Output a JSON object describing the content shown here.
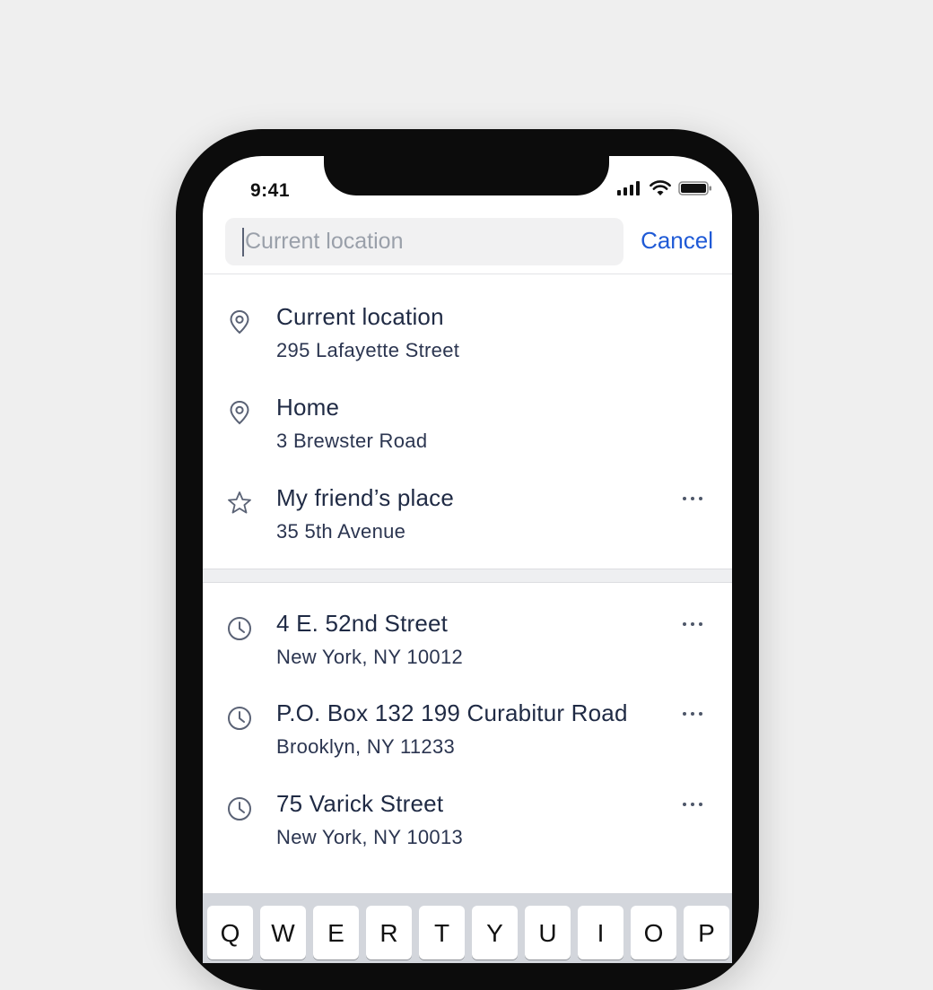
{
  "status_bar": {
    "time": "9:41"
  },
  "search": {
    "placeholder": "Current location",
    "value": "",
    "cancel_label": "Cancel"
  },
  "saved_places": [
    {
      "icon": "location-pin-icon",
      "title": "Current location",
      "subtitle": "295 Lafayette Street",
      "has_more": false
    },
    {
      "icon": "location-pin-icon",
      "title": "Home",
      "subtitle": "3 Brewster Road",
      "has_more": false
    },
    {
      "icon": "star-icon",
      "title": "My friend’s place",
      "subtitle": "35 5th Avenue",
      "has_more": true
    }
  ],
  "recent_places": [
    {
      "icon": "clock-icon",
      "title": "4 E. 52nd Street",
      "subtitle": "New York, NY 10012",
      "has_more": true
    },
    {
      "icon": "clock-icon",
      "title": "P.O. Box 132 199 Curabitur Road",
      "subtitle": "Brooklyn, NY 11233",
      "has_more": true
    },
    {
      "icon": "clock-icon",
      "title": "75 Varick Street",
      "subtitle": "New York, NY 10013",
      "has_more": true
    }
  ],
  "keyboard": {
    "top_row": [
      "Q",
      "W",
      "E",
      "R",
      "T",
      "Y",
      "U",
      "I",
      "O",
      "P"
    ]
  },
  "colors": {
    "accent": "#1f5ad6",
    "text_primary": "#1f2a44",
    "icon": "#5a6275",
    "background": "#efefef"
  }
}
